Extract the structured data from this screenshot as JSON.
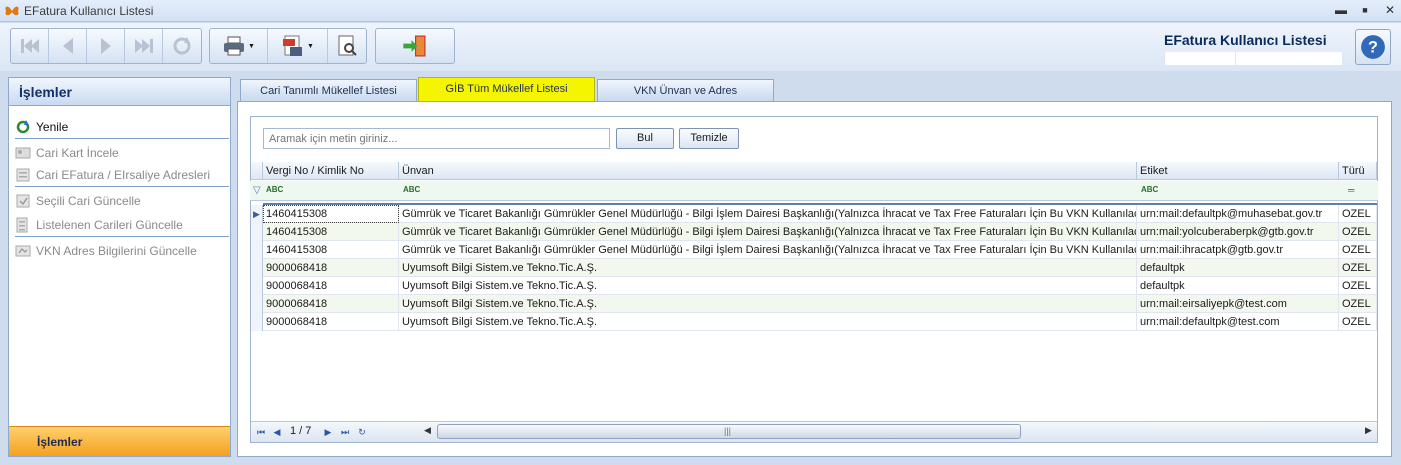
{
  "window": {
    "title": "EFatura Kullanıcı Listesi",
    "minimize": "▬",
    "maximize": "■",
    "close": "✕"
  },
  "header": {
    "page_title": "EFatura Kullanıcı Listesi"
  },
  "left_panel": {
    "title": "İşlemler",
    "items": [
      {
        "label": "Yenile",
        "enabled": true
      },
      {
        "label": "Cari Kart İncele",
        "enabled": false
      },
      {
        "label": "Cari EFatura / EIrsaliye Adresleri",
        "enabled": false
      },
      {
        "label": "Seçili Cari Güncelle",
        "enabled": false
      },
      {
        "label": "Listelenen Carileri Güncelle",
        "enabled": false
      },
      {
        "label": "VKN Adres Bilgilerini Güncelle",
        "enabled": false
      }
    ],
    "footer": "İşlemler"
  },
  "tabs": [
    {
      "label": "Cari Tanımlı Mükellef Listesi",
      "active": false
    },
    {
      "label": "GİB Tüm Mükellef Listesi",
      "active": true
    },
    {
      "label": "VKN Ünvan ve Adres",
      "active": false
    }
  ],
  "search": {
    "placeholder": "Aramak için metin giriniz...",
    "find_label": "Bul",
    "clear_label": "Temizle"
  },
  "grid": {
    "columns": [
      "Vergi No / Kimlik No",
      "Ünvan",
      "Etiket",
      "Türü"
    ],
    "filter_marker": "ABC",
    "rows": [
      [
        "1460415308",
        "Gümrük ve Ticaret Bakanlığı Gümrükler Genel Müdürlüğü - Bilgi İşlem Dairesi Başkanlığı(Yalnızca  İhracat ve Tax Free Faturaları İçin Bu VKN Kullanılacaktır.)",
        "urn:mail:defaultpk@muhasebat.gov.tr",
        "OZEL"
      ],
      [
        "1460415308",
        "Gümrük ve Ticaret Bakanlığı Gümrükler Genel Müdürlüğü - Bilgi İşlem Dairesi Başkanlığı(Yalnızca  İhracat ve Tax Free Faturaları İçin Bu VKN Kullanılacaktır.)",
        "urn:mail:yolcuberaberpk@gtb.gov.tr",
        "OZEL"
      ],
      [
        "1460415308",
        "Gümrük ve Ticaret Bakanlığı Gümrükler Genel Müdürlüğü - Bilgi İşlem Dairesi Başkanlığı(Yalnızca  İhracat ve Tax Free Faturaları İçin Bu VKN Kullanılacaktır.)",
        "urn:mail:ihracatpk@gtb.gov.tr",
        "OZEL"
      ],
      [
        "9000068418",
        "Uyumsoft Bilgi Sistem.ve Tekno.Tic.A.Ş.",
        "defaultpk",
        "OZEL"
      ],
      [
        "9000068418",
        "Uyumsoft Bilgi Sistem.ve Tekno.Tic.A.Ş.",
        "defaultpk",
        "OZEL"
      ],
      [
        "9000068418",
        "Uyumsoft Bilgi Sistem.ve Tekno.Tic.A.Ş.",
        "urn:mail:eirsaliyepk@test.com",
        "OZEL"
      ],
      [
        "9000068418",
        "Uyumsoft Bilgi Sistem.ve Tekno.Tic.A.Ş.",
        "urn:mail:defaultpk@test.com",
        "OZEL"
      ]
    ]
  },
  "pager": {
    "page_text": "1 / 7"
  }
}
